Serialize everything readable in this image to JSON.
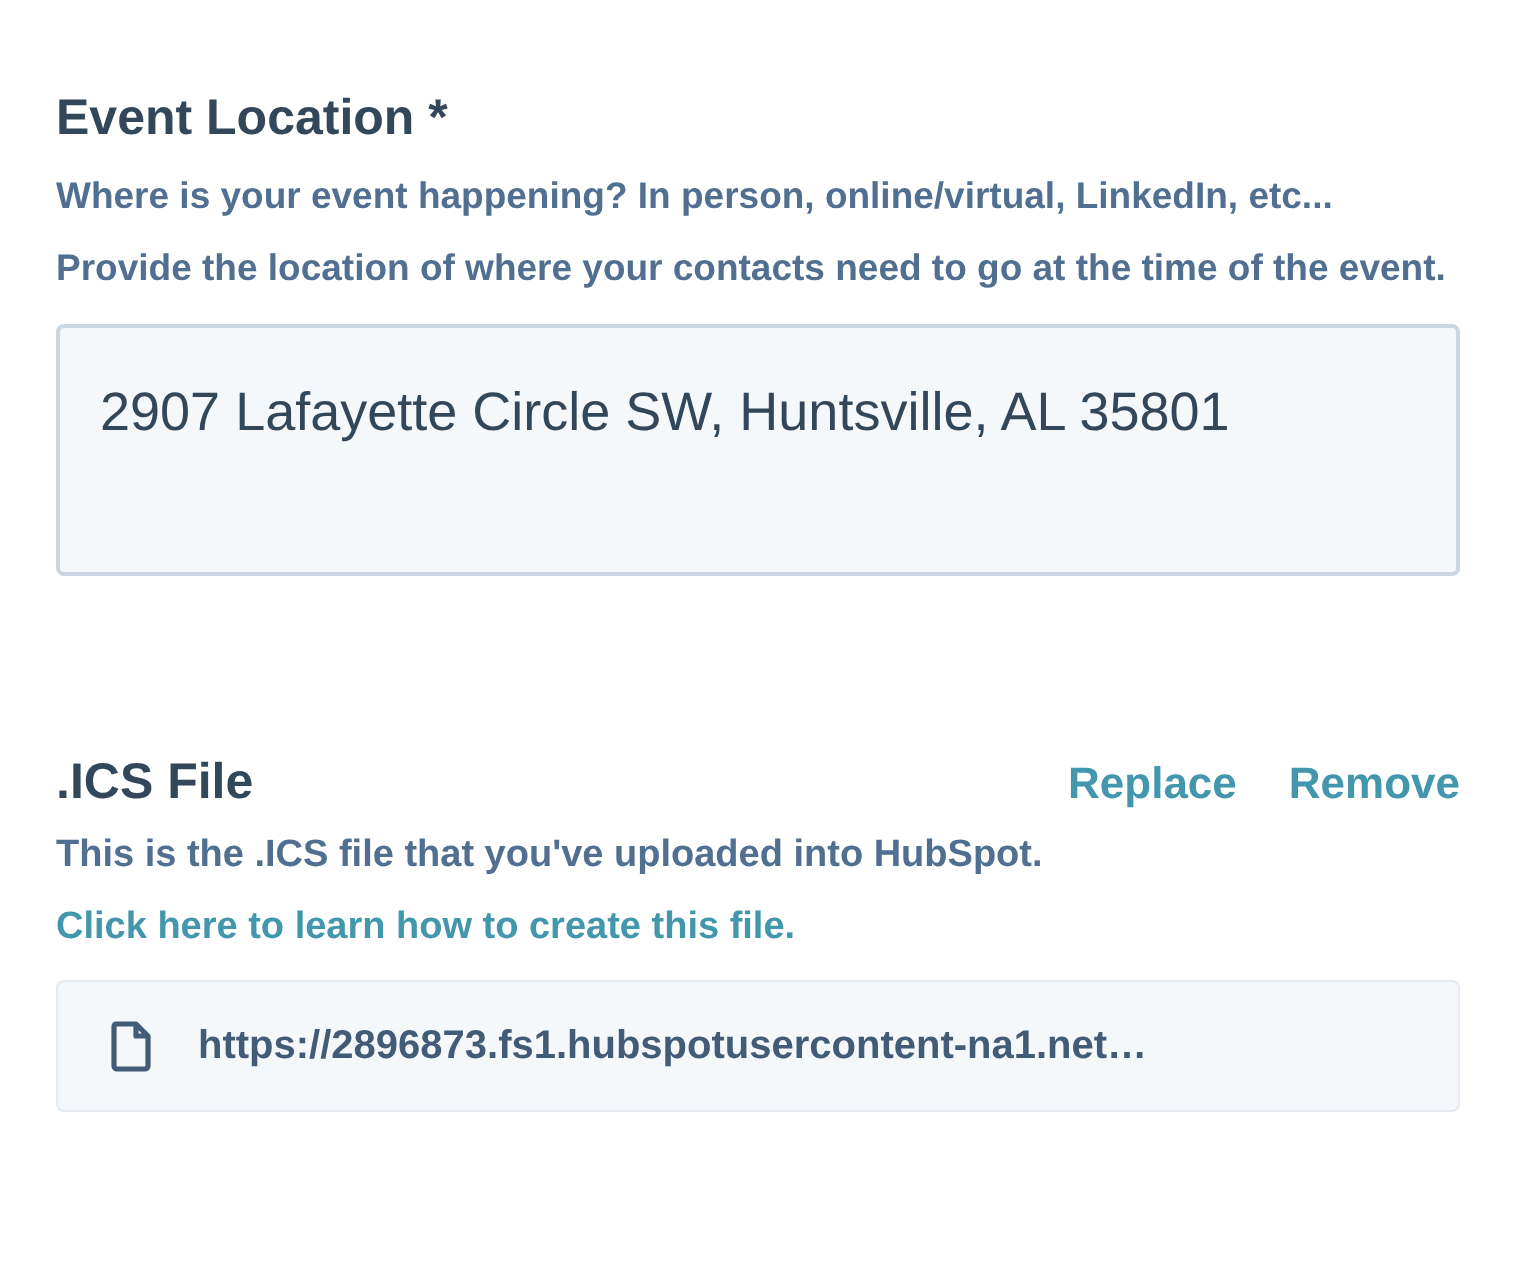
{
  "location": {
    "label": "Event Location *",
    "help": "Where is your event happening? In person, online/virtual, LinkedIn, etc... Provide the location of where your contacts need to go at the time of the event.",
    "value": "2907 Lafayette Circle SW, Huntsville, AL 35801"
  },
  "ics": {
    "label": ".ICS File",
    "actions": [
      "Replace",
      "Remove"
    ],
    "help": "This is the .ICS file that you've uploaded into HubSpot.",
    "link": "Click here to learn how to create this file.",
    "file": "https://2896873.fs1.hubspotusercontent-na1.net…"
  }
}
